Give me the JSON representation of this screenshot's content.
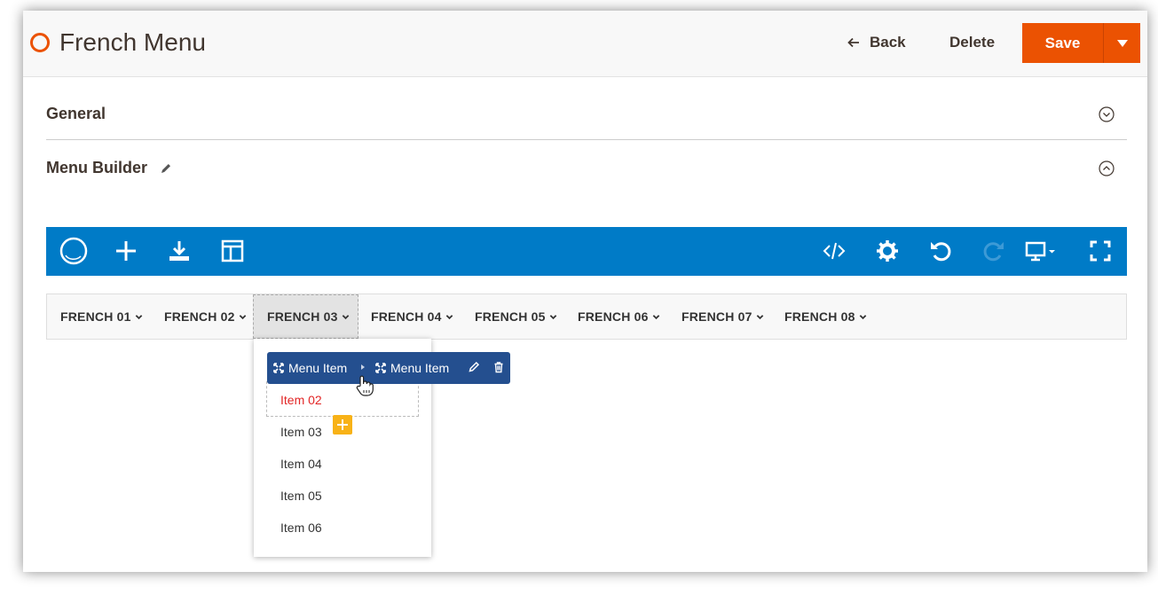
{
  "header": {
    "title": "French Menu",
    "back_label": "Back",
    "delete_label": "Delete",
    "save_label": "Save",
    "accent_color": "#eb5202"
  },
  "sections": {
    "general_label": "General",
    "builder_label": "Menu Builder"
  },
  "toolbar": {
    "color": "#007bc7",
    "left_icons": [
      "logo-icon",
      "plus-icon",
      "download-icon",
      "layout-icon"
    ],
    "right_icons": [
      "code-icon",
      "gear-icon",
      "undo-icon",
      "redo-icon",
      "monitor-icon",
      "fullscreen-icon"
    ]
  },
  "menubar": {
    "tabs": [
      "FRENCH 01",
      "FRENCH 02",
      "FRENCH 03",
      "FRENCH 04",
      "FRENCH 05",
      "FRENCH 06",
      "FRENCH 07",
      "FRENCH 08"
    ],
    "active_tab": "FRENCH 03"
  },
  "dropdown": {
    "items": [
      "Item 02",
      "Item 03",
      "Item 04",
      "Item 05",
      "Item 06"
    ],
    "active_item": "Item 02"
  },
  "breadcrumb": {
    "items": [
      "Menu Item",
      "Menu Item"
    ],
    "color": "#244f8f"
  }
}
